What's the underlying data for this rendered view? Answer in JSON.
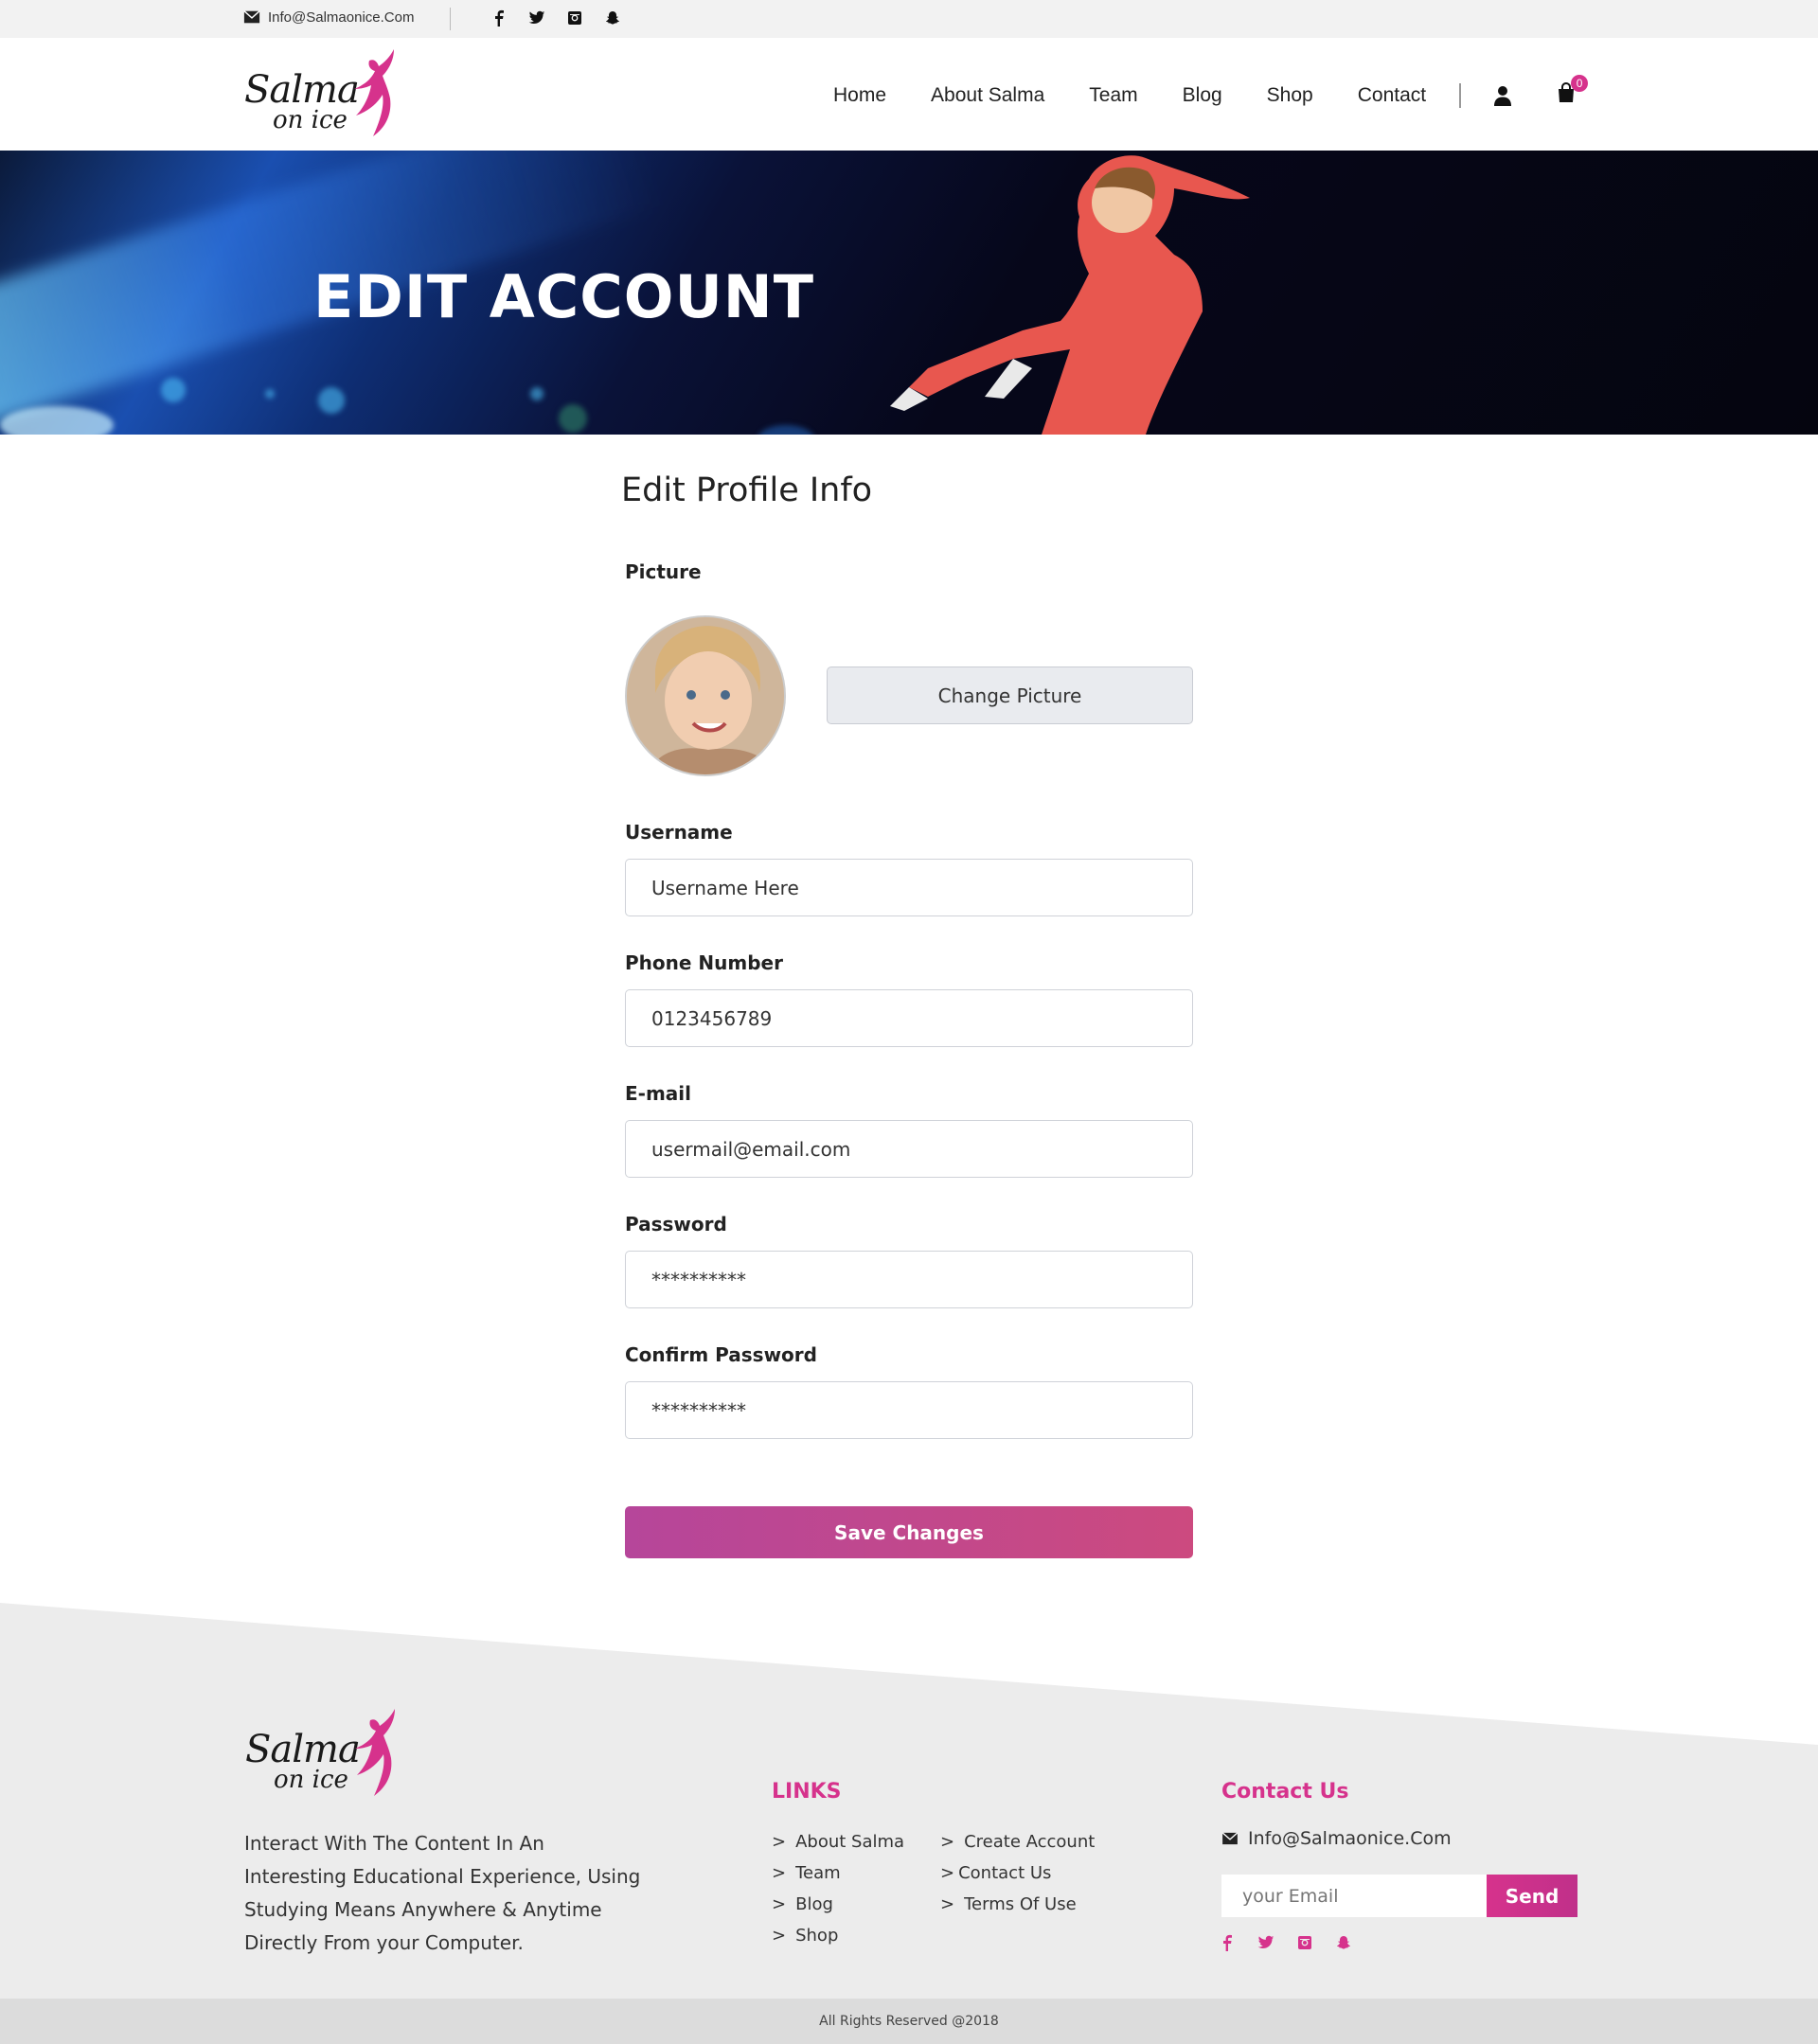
{
  "topbar": {
    "email": "Info@Salmaonice.Com",
    "socials": [
      "facebook-icon",
      "twitter-icon",
      "instagram-icon",
      "snapchat-icon"
    ]
  },
  "brand": {
    "line1": "Salma",
    "line2": "on ice",
    "accent": "#d6328c"
  },
  "nav": {
    "items": [
      "Home",
      "About Salma",
      "Team",
      "Blog",
      "Shop",
      "Contact"
    ],
    "cart_count": "0"
  },
  "hero": {
    "title": "EDIT ACCOUNT"
  },
  "form": {
    "title": "Edit Profile Info",
    "picture_label": "Picture",
    "change_picture": "Change Picture",
    "username_label": "Username",
    "username_value": "Username Here",
    "phone_label": "Phone Number",
    "phone_value": "0123456789",
    "email_label": "E-mail",
    "email_value": "usermail@email.com",
    "password_label": "Password",
    "password_value": "**********",
    "confirm_label": "Confirm Password",
    "confirm_value": "**********",
    "save": "Save Changes",
    "save_color": "#c0478e"
  },
  "footer": {
    "description": "Interact With The Content In An Interesting Educational Experience, Using Studying Means Anywhere & Anytime Directly From your Computer.",
    "links_title": "LINKS",
    "links_col1": [
      "About Salma",
      "Team",
      "Blog",
      "Shop"
    ],
    "links_col2": [
      "Create Account",
      "Contact Us",
      "Terms Of Use"
    ],
    "contact_title": "Contact Us",
    "contact_email": "Info@Salmaonice.Com",
    "newsletter_placeholder": "your Email",
    "send": "Send",
    "copyright": "All Rights Reserved @2018"
  }
}
